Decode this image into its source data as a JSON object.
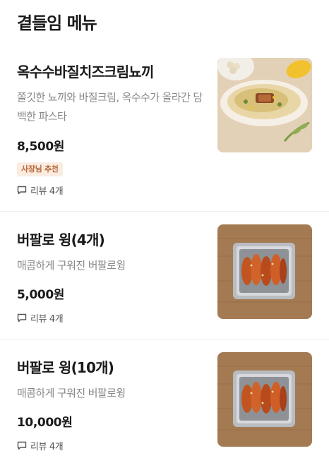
{
  "section": {
    "title": "곁들임 메뉴"
  },
  "items": [
    {
      "name": "옥수수바질치즈크림뇨끼",
      "description": "쫄깃한 뇨끼와 바질크림, 옥수수가 올라간 담백한 파스타",
      "price": "8,500원",
      "badge": "사장님 추천",
      "review": "리뷰 4개",
      "image_icon": "gnocchi-dish-photo"
    },
    {
      "name": "버팔로 윙(4개)",
      "description": "매콤하게 구워진 버팔로윙",
      "price": "5,000원",
      "review": "리뷰 4개",
      "image_icon": "buffalo-wings-photo"
    },
    {
      "name": "버팔로 윙(10개)",
      "description": "매콤하게 구워진 버팔로윙",
      "price": "10,000원",
      "review": "리뷰 4개",
      "image_icon": "buffalo-wings-photo"
    }
  ],
  "colors": {
    "badge_bg": "#fbece1",
    "badge_text": "#b8683a",
    "description_text": "#888888",
    "divider": "#eeeeee"
  }
}
